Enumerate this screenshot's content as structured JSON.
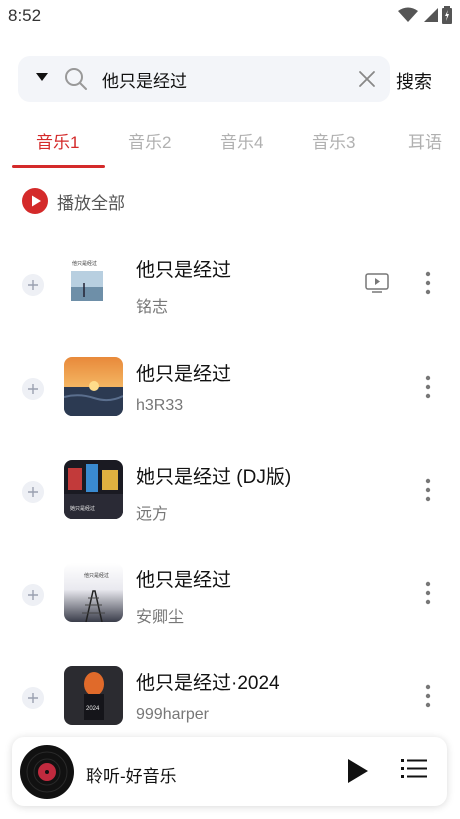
{
  "status_bar": {
    "time": "8:52"
  },
  "search": {
    "value": "他只是经过",
    "button_label": "搜索"
  },
  "tabs": [
    {
      "label": "音乐1",
      "active": true
    },
    {
      "label": "音乐2",
      "active": false
    },
    {
      "label": "音乐4",
      "active": false
    },
    {
      "label": "音乐3",
      "active": false
    },
    {
      "label": "耳语",
      "active": false
    }
  ],
  "play_all": {
    "label": "播放全部"
  },
  "songs": [
    {
      "title": "他只是经过",
      "artist": "铭志",
      "has_mv": true,
      "cover_text": "他只是经过"
    },
    {
      "title": "他只是经过",
      "artist": "h3R33",
      "has_mv": false
    },
    {
      "title": "她只是经过 (DJ版)",
      "artist": "远方",
      "has_mv": false,
      "cover_text": "她只是经过"
    },
    {
      "title": "他只是经过",
      "artist": "安卿尘",
      "has_mv": false,
      "cover_text": "他只是经过"
    },
    {
      "title": "他只是经过·2024",
      "artist": "999harper",
      "has_mv": false,
      "cover_text": "2024"
    }
  ],
  "player": {
    "title": "聆听-好音乐"
  },
  "colors": {
    "accent": "#d42a2a",
    "search_bg": "#f3f5f9"
  }
}
